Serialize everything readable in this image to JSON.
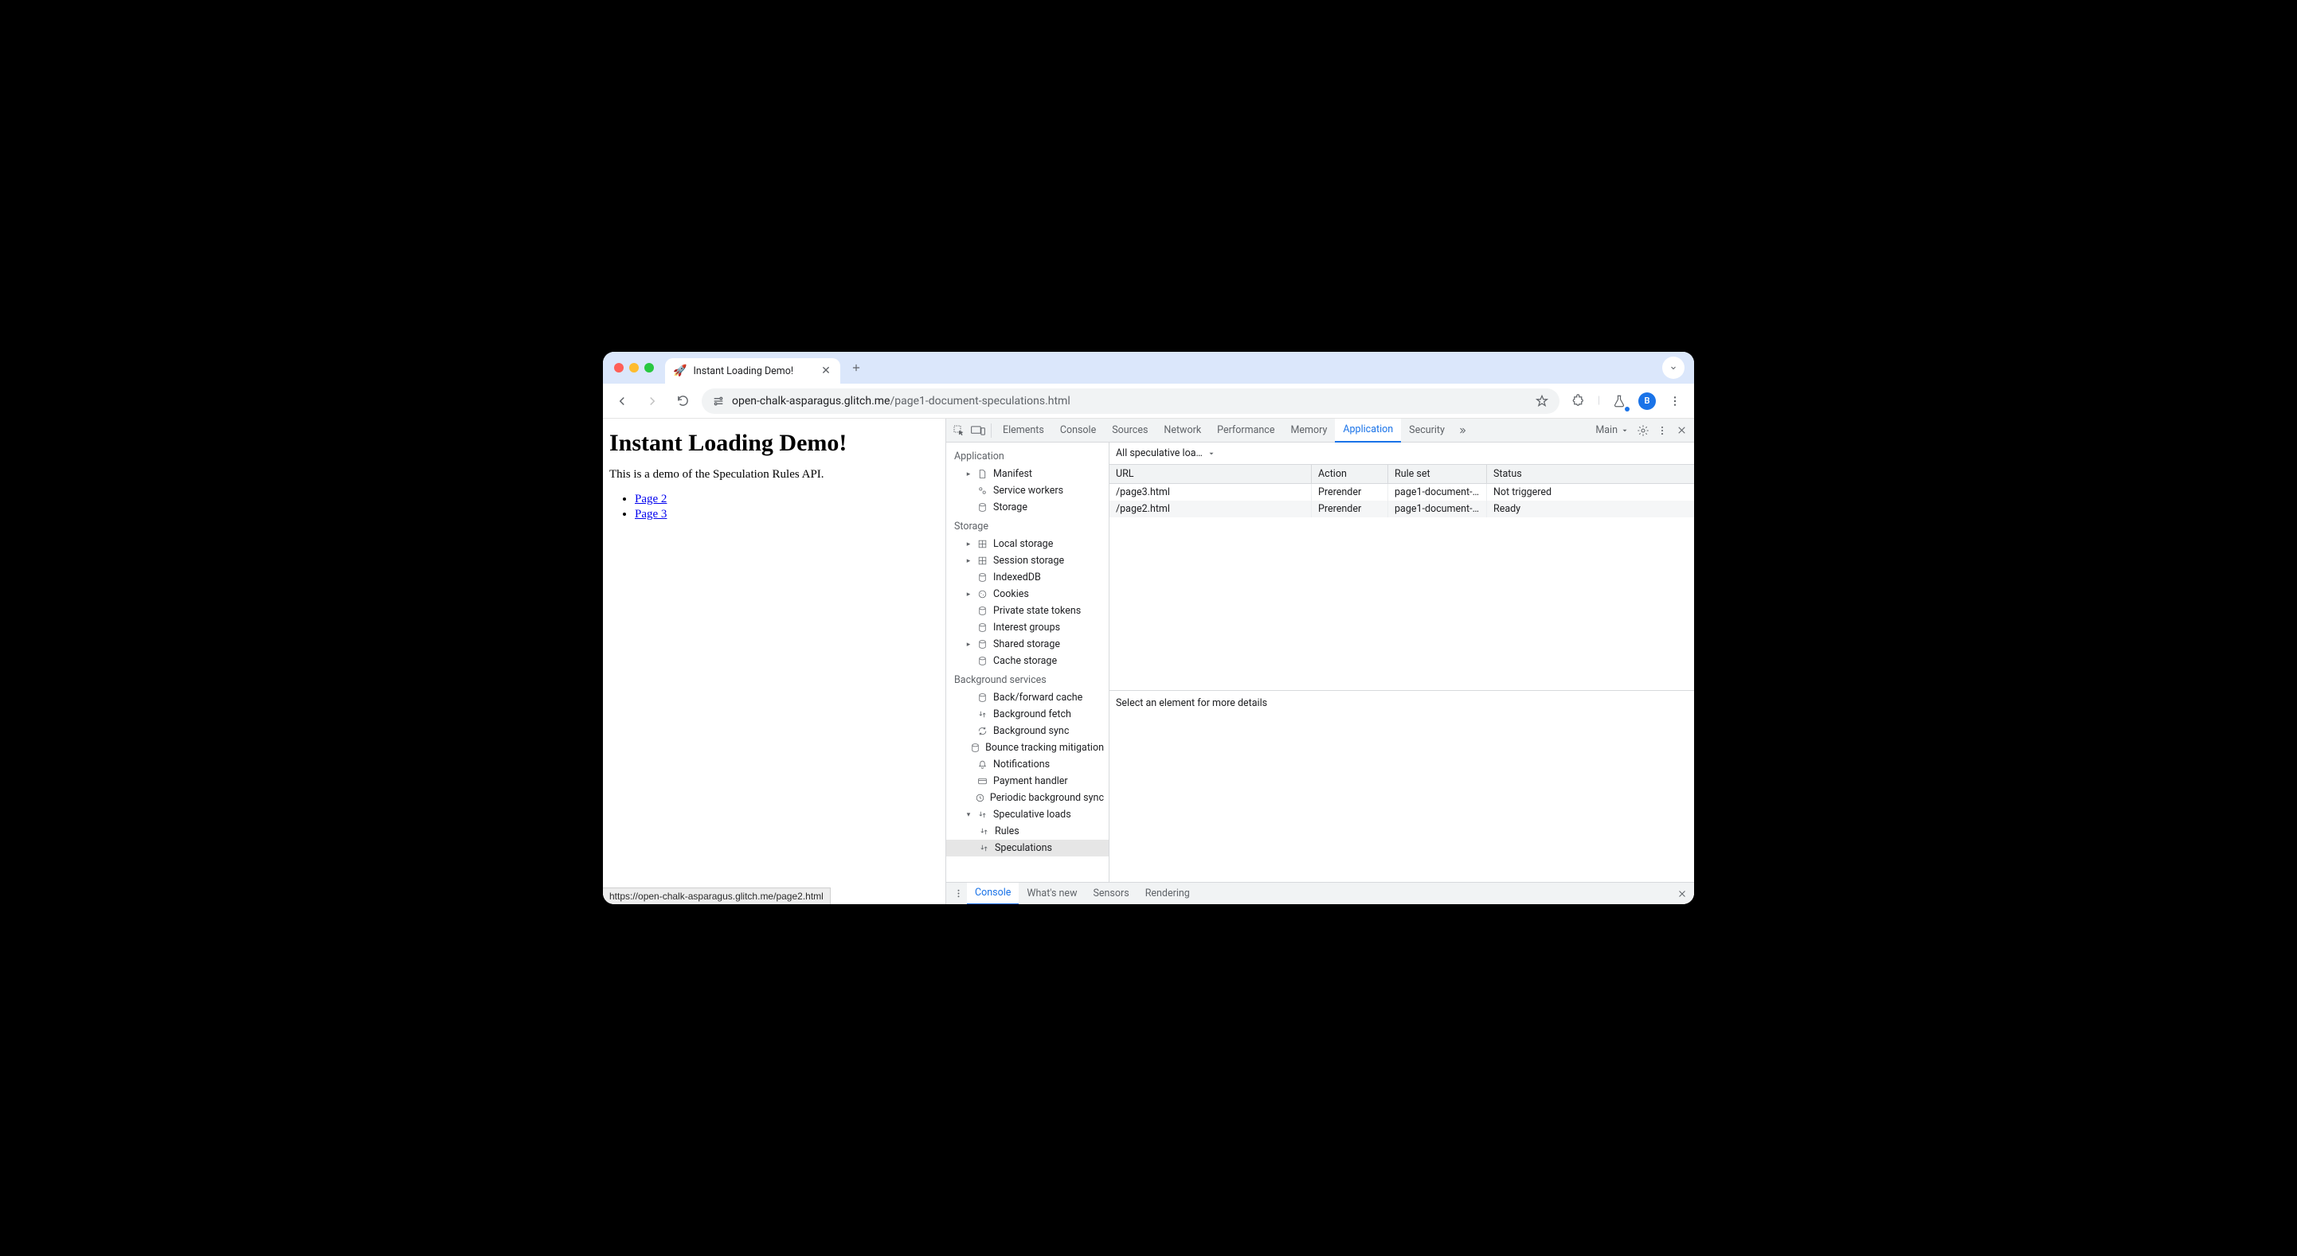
{
  "window": {
    "tab_title": "Instant Loading Demo!",
    "favicon": "🚀"
  },
  "toolbar": {
    "url_host": "open-chalk-asparagus.glitch.me",
    "url_path": "/page1-document-speculations.html",
    "avatar_letter": "B"
  },
  "page": {
    "heading": "Instant Loading Demo!",
    "intro": "This is a demo of the Speculation Rules API.",
    "links": [
      "Page 2",
      "Page 3"
    ],
    "status_url": "https://open-chalk-asparagus.glitch.me/page2.html"
  },
  "devtools": {
    "tabs": [
      "Elements",
      "Console",
      "Sources",
      "Network",
      "Performance",
      "Memory",
      "Application",
      "Security"
    ],
    "active_tab": "Application",
    "target_label": "Main",
    "side": {
      "application_heading": "Application",
      "application_items": [
        "Manifest",
        "Service workers",
        "Storage"
      ],
      "storage_heading": "Storage",
      "storage_items": [
        "Local storage",
        "Session storage",
        "IndexedDB",
        "Cookies",
        "Private state tokens",
        "Interest groups",
        "Shared storage",
        "Cache storage"
      ],
      "bg_heading": "Background services",
      "bg_items": [
        "Back/forward cache",
        "Background fetch",
        "Background sync",
        "Bounce tracking mitigation",
        "Notifications",
        "Payment handler",
        "Periodic background sync",
        "Speculative loads"
      ],
      "spec_children": [
        "Rules",
        "Speculations"
      ],
      "selected": "Speculations"
    },
    "filter_label": "All speculative loa…",
    "grid": {
      "headers": [
        "URL",
        "Action",
        "Rule set",
        "Status"
      ],
      "rows": [
        {
          "url": "/page3.html",
          "action": "Prerender",
          "ruleset": "page1-document-…",
          "status": "Not triggered"
        },
        {
          "url": "/page2.html",
          "action": "Prerender",
          "ruleset": "page1-document-…",
          "status": "Ready"
        }
      ]
    },
    "details_hint": "Select an element for more details",
    "drawer_tabs": [
      "Console",
      "What's new",
      "Sensors",
      "Rendering"
    ],
    "drawer_active": "Console"
  }
}
